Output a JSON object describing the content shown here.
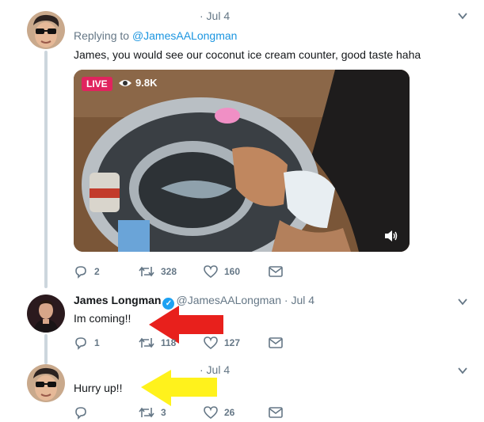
{
  "tweets": [
    {
      "date": "· Jul 4",
      "replying_label": "Replying to ",
      "replying_handle": "@JamesAALongman",
      "text": "James, you would see our coconut ice cream counter, good taste haha",
      "media": {
        "badge": "LIVE",
        "views": "9.8K",
        "icons": [
          "eye-icon",
          "volume-icon"
        ]
      },
      "stats": {
        "replies": "2",
        "retweets": "328",
        "likes": "160"
      }
    },
    {
      "name": "James Longman",
      "handle": "@JamesAALongman",
      "date": "· Jul 4",
      "text": "Im coming!!",
      "stats": {
        "replies": "1",
        "retweets": "118",
        "likes": "127"
      }
    },
    {
      "date": "· Jul 4",
      "text": "Hurry up!!",
      "stats": {
        "replies": "",
        "retweets": "3",
        "likes": "26"
      }
    }
  ],
  "annotations": {
    "arrow1_color": "#e8201c",
    "arrow2_color": "#fff21c"
  },
  "colors": {
    "accent": "#1da1f2",
    "live": "#e0245e",
    "muted": "#657786"
  }
}
